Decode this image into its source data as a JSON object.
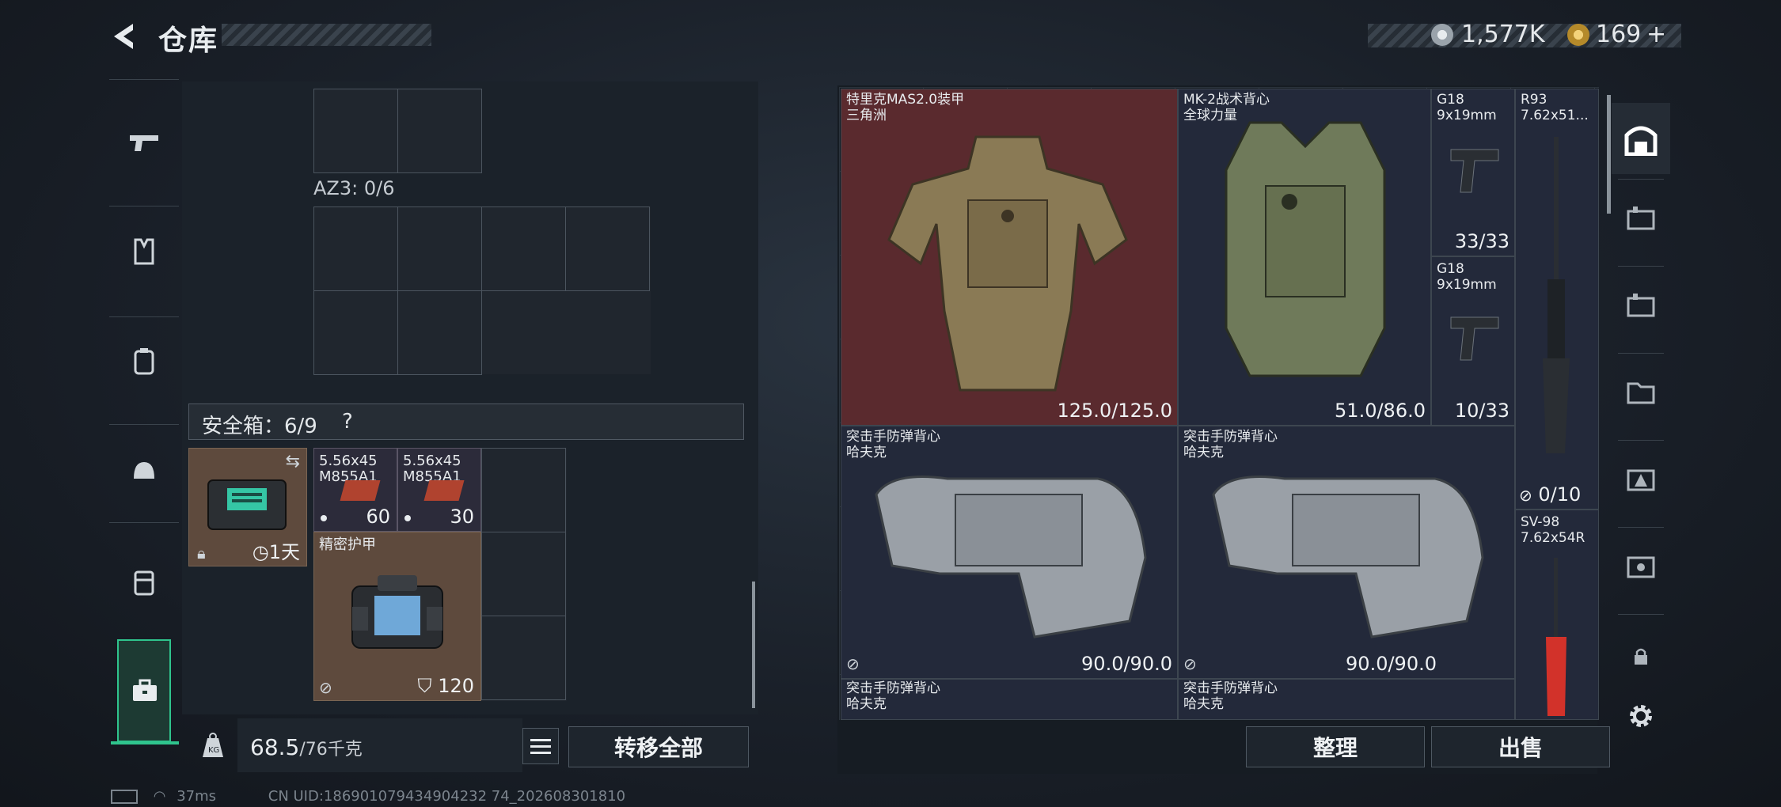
{
  "header": {
    "title": "仓库",
    "currency": [
      {
        "icon": "silver-coin-icon",
        "value": "1,577K"
      },
      {
        "icon": "gold-coin-icon",
        "value": "169",
        "suffix": "+"
      }
    ]
  },
  "left_nav": {
    "items": [
      {
        "icon": "pistol-icon"
      },
      {
        "icon": "vest-icon"
      },
      {
        "icon": "backpack-icon"
      },
      {
        "icon": "helmet-icon"
      },
      {
        "icon": "rig-icon"
      },
      {
        "icon": "briefcase-icon",
        "active": true
      }
    ]
  },
  "inventory": {
    "container_label": "AZ3: 0/6",
    "safe_box_label": "安全箱：6/9",
    "safe_box_help": "?",
    "safe_items": [
      {
        "icon": "device-case-icon",
        "timer": "1天"
      },
      {
        "name": "5.56x45\nM855A1",
        "count": "60"
      },
      {
        "name": "5.56x45\nM855A1",
        "count": "30"
      },
      {
        "name": "精密护甲",
        "durability": "120"
      }
    ],
    "weight_value": "68.5",
    "weight_max": "/76千克",
    "transfer_all_label": "转移全部"
  },
  "stash": {
    "items": [
      {
        "name": "特里克MAS2.0装甲",
        "sub": "三角洲",
        "durability": "125.0/125.0"
      },
      {
        "name": "MK-2战术背心",
        "sub": "全球力量",
        "durability": "51.0/86.0"
      },
      {
        "name": "G18",
        "sub": "9x19mm",
        "count": "33/33"
      },
      {
        "name": "R93",
        "sub": "7.62x51...",
        "count": "0/10"
      },
      {
        "name": "G18",
        "sub": "9x19mm",
        "count": "10/33"
      },
      {
        "name": "突击手防弹背心",
        "sub": "哈夫克",
        "durability": "90.0/90.0"
      },
      {
        "name": "突击手防弹背心",
        "sub": "哈夫克",
        "durability": "90.0/90.0"
      },
      {
        "name": "SV-98",
        "sub": "7.62x54R"
      },
      {
        "name": "突击手防弹背心",
        "sub": "哈夫克"
      },
      {
        "name": "突击手防弹背心",
        "sub": "哈夫克"
      }
    ],
    "sort_label": "整理",
    "sell_label": "出售"
  },
  "status_bar": {
    "ping": "37ms",
    "uid": "CN UID:186901079434904232 74_202608301810"
  },
  "colors": {
    "accent": "#2fc48d",
    "armor_bg": "#5a2a2e",
    "panel": "#1b222a"
  }
}
